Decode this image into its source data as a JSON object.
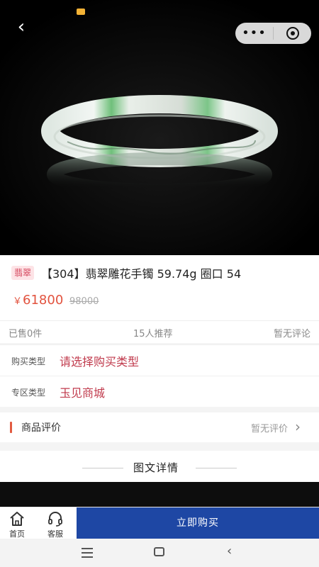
{
  "header": {
    "back_icon": "chevron-left-icon",
    "more_icon": "more-dots-icon",
    "more_glyph": "•••",
    "target_icon": "target-icon"
  },
  "product": {
    "tag": "翡翠",
    "title": "【304】翡翠雕花手镯 59.74g 圈口 54",
    "price_symbol": "￥",
    "price": "61800",
    "original_price": "98000"
  },
  "stats": {
    "sold": "已售0件",
    "recommended": "15人推荐",
    "reviews": "暂无评论"
  },
  "options": {
    "buy_type_label": "购买类型",
    "buy_type_value": "请选择购买类型",
    "zone_type_label": "专区类型",
    "zone_type_value": "玉见商城"
  },
  "review": {
    "title": "商品评价",
    "status": "暂无评价",
    "chevron": "›"
  },
  "detail": {
    "title": "图文详情"
  },
  "bottom_bar": {
    "home_label": "首页",
    "service_label": "客服",
    "buy_label": "立即购买"
  },
  "system_nav": {
    "back_glyph": "‹"
  },
  "colors": {
    "accent_blue": "#1e47a4",
    "price_red": "#e2533f",
    "value_red": "#c03a4c"
  }
}
